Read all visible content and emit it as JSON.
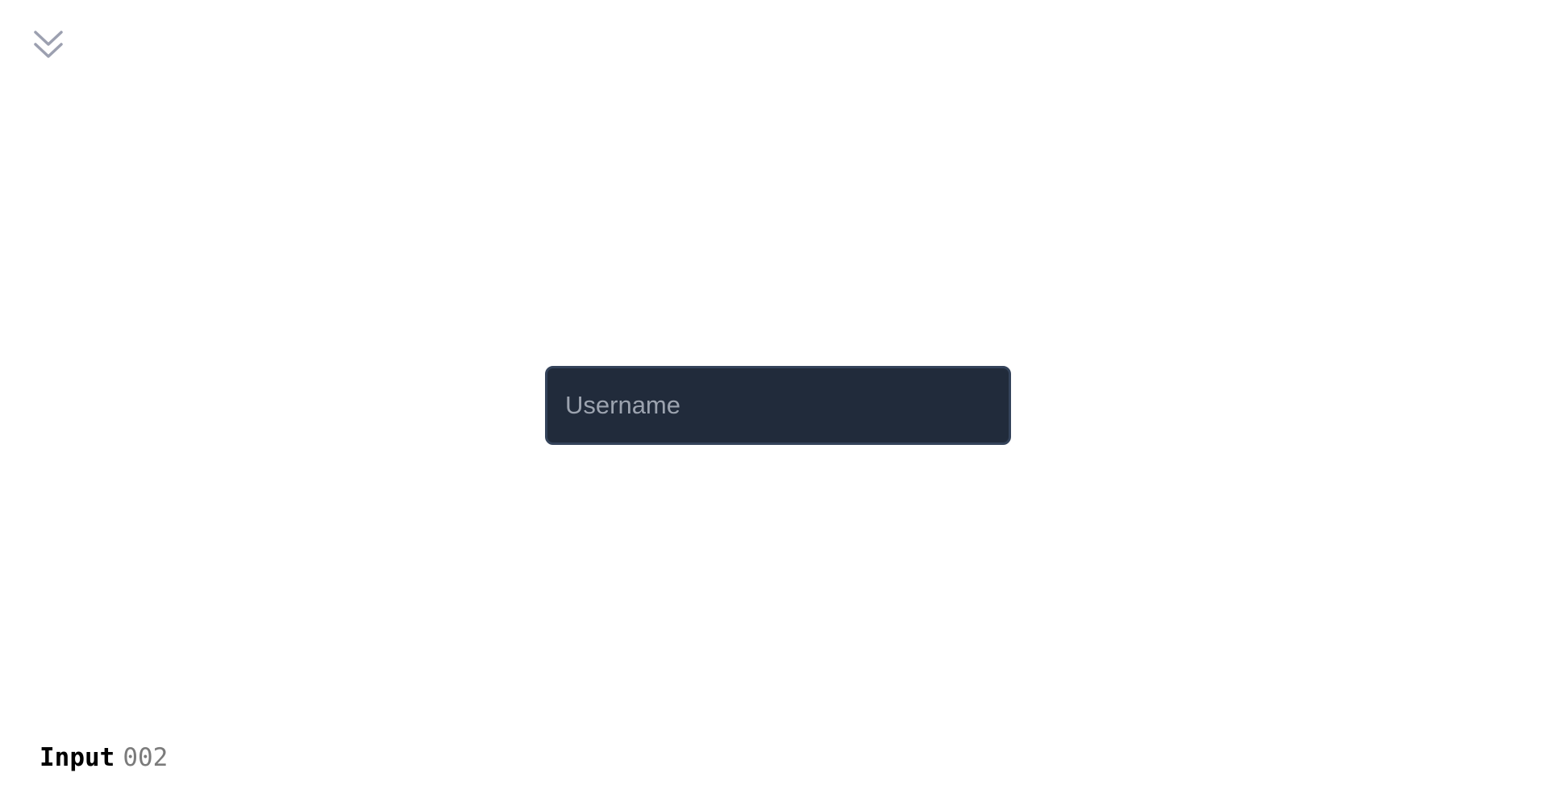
{
  "top_icon": {
    "name": "chevrons-down-icon",
    "color": "#9ca0b0"
  },
  "input": {
    "placeholder": "Username",
    "value": ""
  },
  "caption": {
    "title": "Input",
    "number": "002"
  },
  "colors": {
    "background": "#ffffff",
    "input_bg": "#212b3b",
    "input_border": "#34435a",
    "placeholder": "#9ca3af"
  }
}
